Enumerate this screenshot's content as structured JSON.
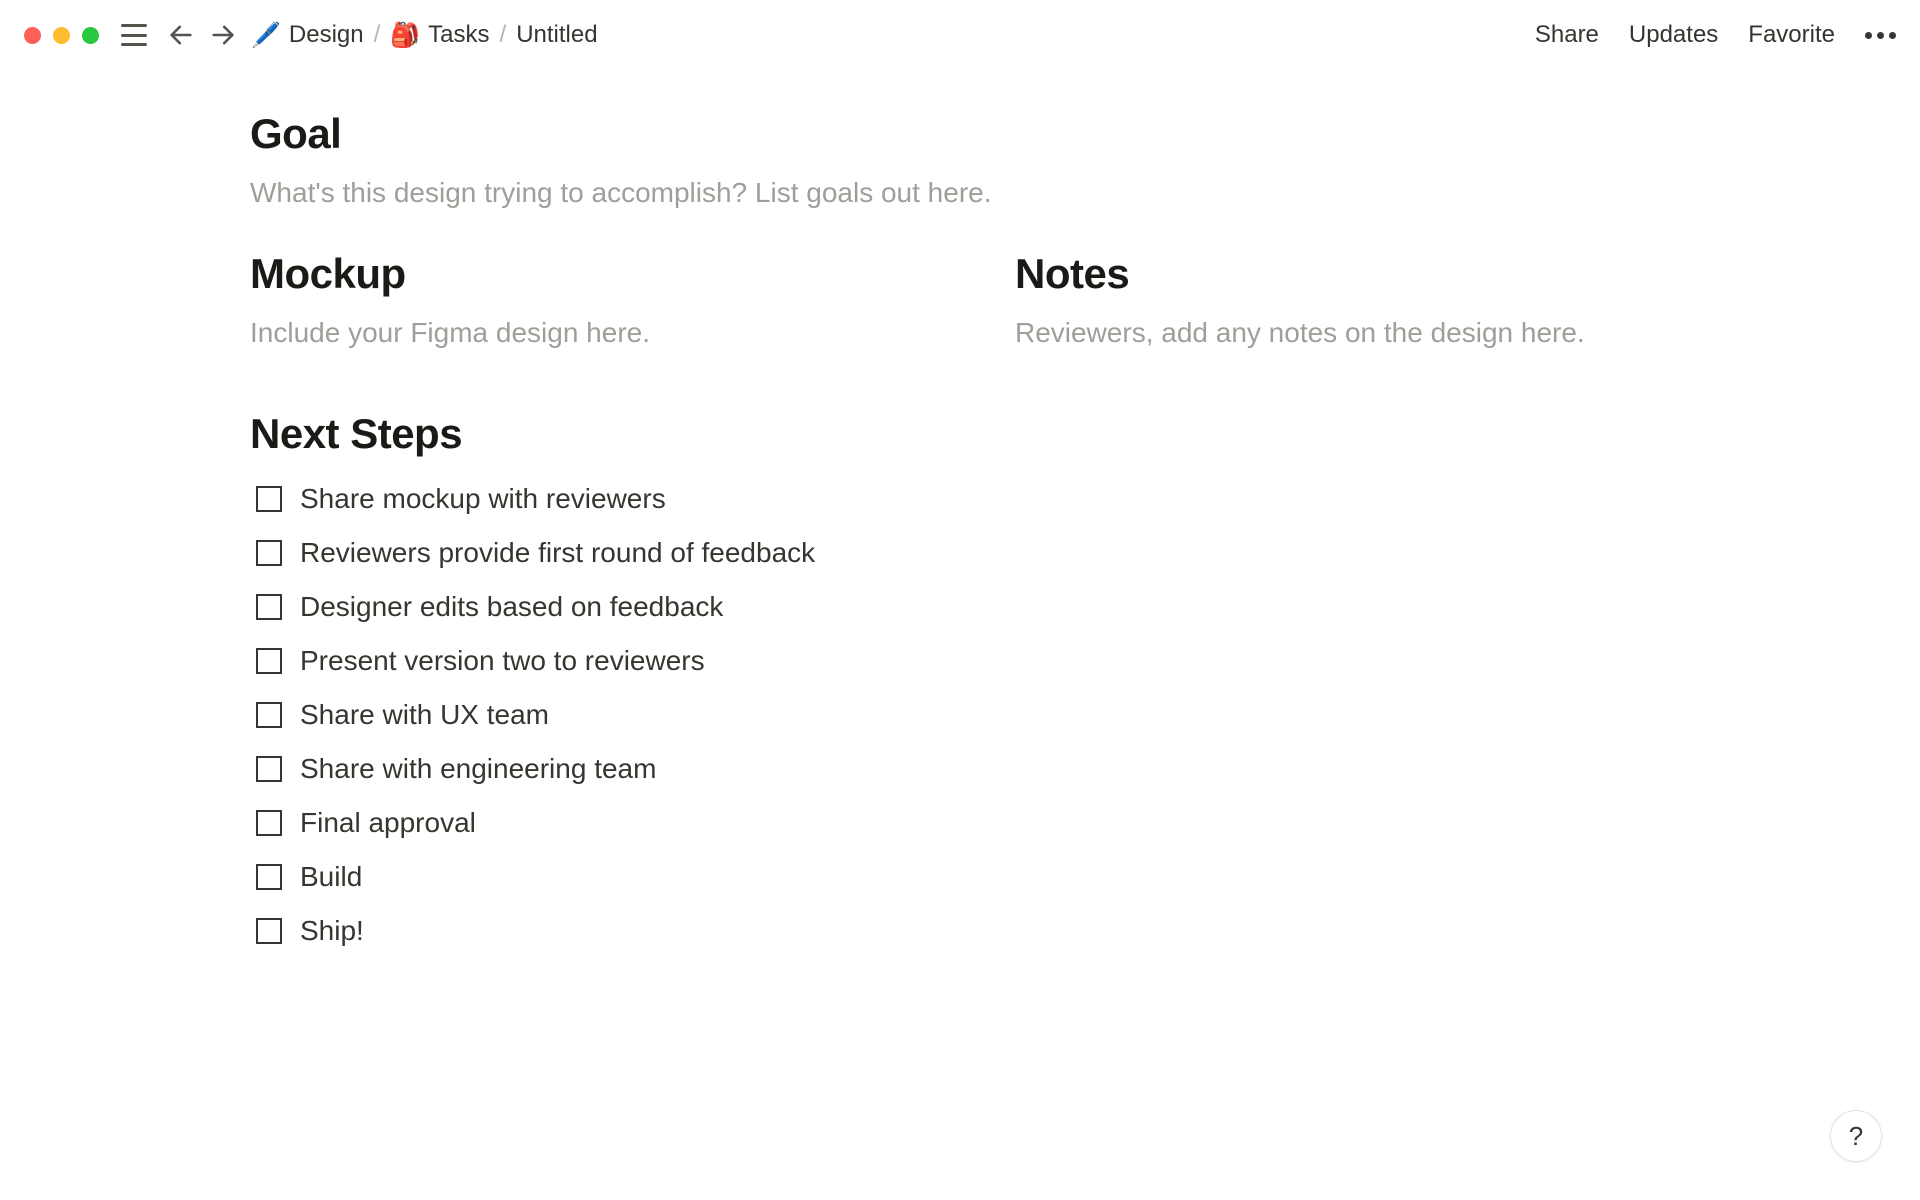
{
  "breadcrumb": {
    "items": [
      {
        "icon": "🖊️",
        "label": "Design"
      },
      {
        "icon": "🎒",
        "label": "Tasks"
      },
      {
        "icon": "",
        "label": "Untitled"
      }
    ],
    "separator": "/"
  },
  "topbar": {
    "share": "Share",
    "updates": "Updates",
    "favorite": "Favorite"
  },
  "sections": {
    "goal": {
      "heading": "Goal",
      "placeholder": "What's this design trying to accomplish? List goals out here."
    },
    "mockup": {
      "heading": "Mockup",
      "placeholder": "Include your Figma design here."
    },
    "notes": {
      "heading": "Notes",
      "placeholder": "Reviewers, add any notes on the design here."
    },
    "next_steps": {
      "heading": "Next Steps",
      "items": [
        "Share mockup with reviewers",
        "Reviewers provide first round of feedback",
        "Designer edits based on feedback",
        "Present version two to reviewers",
        "Share with UX team",
        "Share with engineering team",
        "Final approval",
        "Build",
        "Ship!"
      ]
    }
  },
  "help_label": "?"
}
